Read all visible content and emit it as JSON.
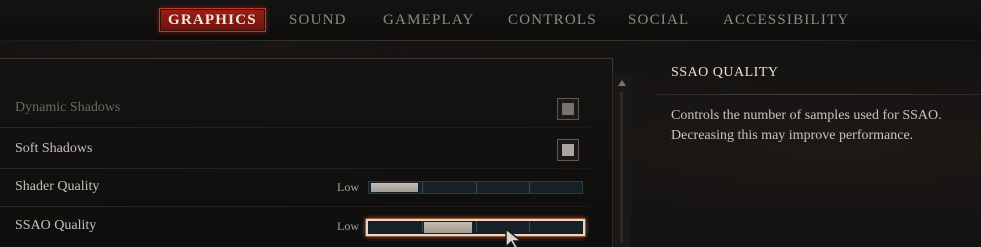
{
  "tabs": [
    {
      "label": "GRAPHICS",
      "active": true
    },
    {
      "label": "SOUND",
      "active": false
    },
    {
      "label": "GAMEPLAY",
      "active": false
    },
    {
      "label": "CONTROLS",
      "active": false
    },
    {
      "label": "SOCIAL",
      "active": false
    },
    {
      "label": "ACCESSIBILITY",
      "active": false
    }
  ],
  "settings": {
    "rows": [
      {
        "label": "Dynamic Shadows",
        "type": "checkbox",
        "checked": true,
        "disabled": true
      },
      {
        "label": "Soft Shadows",
        "type": "checkbox",
        "checked": true,
        "disabled": false
      },
      {
        "label": "Shader Quality",
        "type": "slider",
        "level_text": "Low",
        "level_index": 0,
        "level_count": 4,
        "focused": false
      },
      {
        "label": "SSAO Quality",
        "type": "slider",
        "level_text": "Low",
        "level_index": 1,
        "level_count": 4,
        "focused": true
      }
    ]
  },
  "description": {
    "title": "SSAO QUALITY",
    "text": "Controls the number of samples used for SSAO. Decreasing this may improve performance."
  },
  "colors": {
    "accent_active_tab": "#9a1f16",
    "focus_outline": "#e8d6c6"
  },
  "icons": {
    "scroll_up": "chevron-up-icon",
    "cursor": "mouse-pointer-icon"
  }
}
